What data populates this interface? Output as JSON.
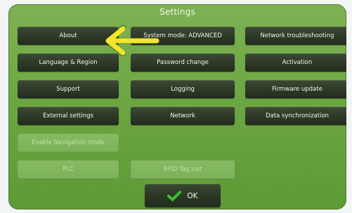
{
  "window": {
    "title": "Settings"
  },
  "buttons": {
    "about": "About",
    "system_mode": "System mode: ADVANCED",
    "network_troubleshooting": "Network troubleshooting",
    "language_region": "Language & Region",
    "password_change": "Password change",
    "activation": "Activation",
    "support": "Support",
    "logging": "Logging",
    "firmware_update": "Firmware update",
    "external_settings": "External settings",
    "network": "Network",
    "data_synchronization": "Data synchronization",
    "enable_navigation_mode": "Enable Navigation mode",
    "plc": "PLC",
    "rfid_tag_list": "RFID Tag List",
    "ok": "OK"
  },
  "colors": {
    "panel_green": "#6ea845",
    "button_dark": "#2d3827",
    "arrow_yellow": "#f3e629",
    "check_green": "#37c22a"
  },
  "icons": {
    "pointer": "arrow-left-icon",
    "ok": "checkmark-icon"
  }
}
